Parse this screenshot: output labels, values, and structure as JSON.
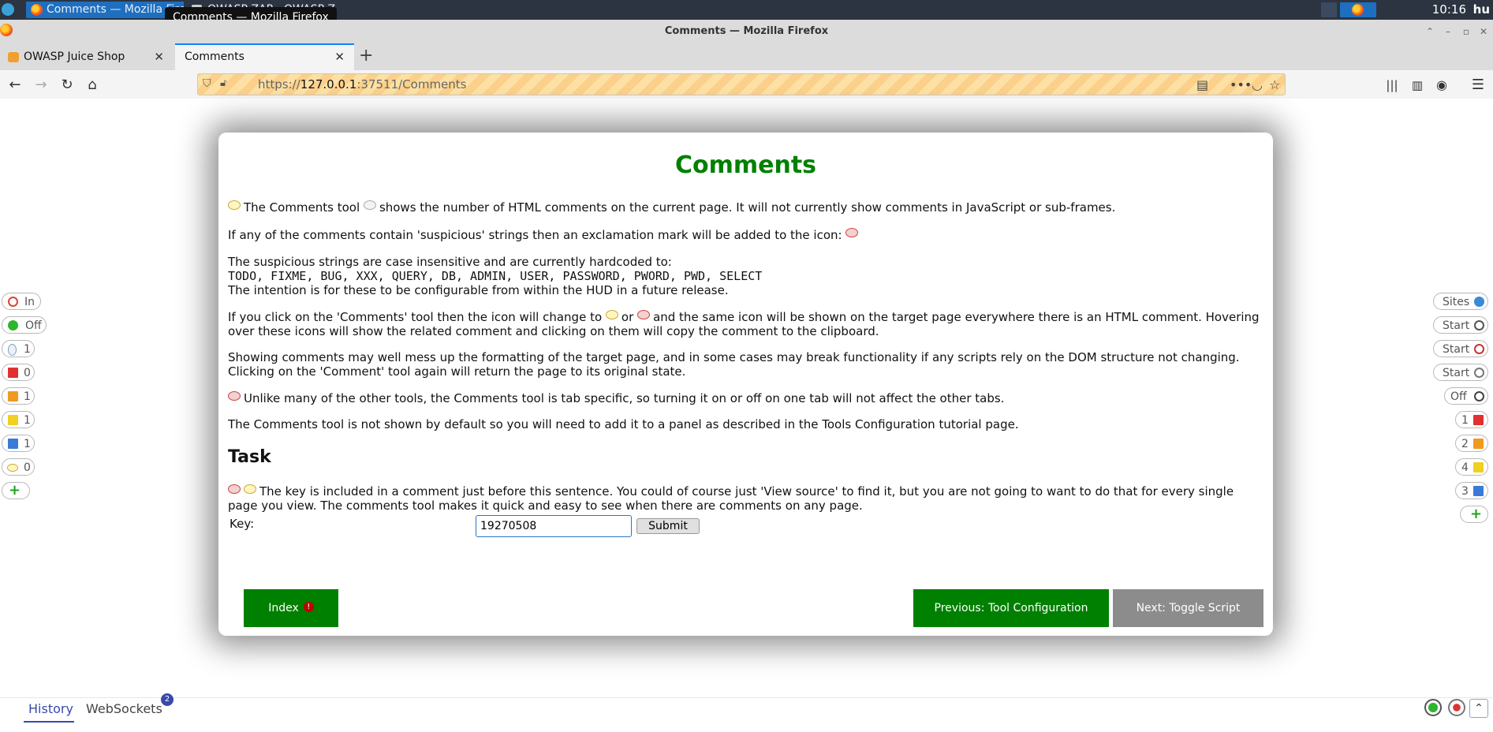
{
  "taskbar": {
    "tasks": [
      "Comments — Mozilla Firefox",
      "OWASP ZAP - OWASP Z..."
    ],
    "tooltip": "Comments — Mozilla Firefox",
    "clock": "10:16",
    "keyboard_layout": "hu"
  },
  "window": {
    "title": "Comments — Mozilla Firefox"
  },
  "tabs": [
    {
      "label": "OWASP Juice Shop",
      "selected": false
    },
    {
      "label": "Comments",
      "selected": true
    }
  ],
  "address": {
    "prefix": "https://",
    "host": "127.0.0.1",
    "rest": ":37511/Comments"
  },
  "dialog": {
    "title": "Comments",
    "p1": "The Comments tool shows the number of HTML comments on the current page. It will not currently show comments in JavaScript or sub-frames.",
    "p1a": "The Comments tool",
    "p1b": "shows the number of HTML comments on the current page. It will not currently show comments in JavaScript or sub-frames.",
    "p2": "If any of the comments contain 'suspicious' strings then an exclamation mark will be added to the icon:",
    "p3_intro": "The suspicious strings are case insensitive and are currently hardcoded to:",
    "p3_code": "TODO, FIXME, BUG, XXX, QUERY, DB, ADMIN, USER, PASSWORD, PWORD, PWD, SELECT",
    "p3_outro": "The intention is for these to be configurable from within the HUD in a future release.",
    "p4a": "If you click on the 'Comments' tool then the icon will change to",
    "p4b": "or",
    "p4c": "and the same icon will be shown on the target page everywhere there is an HTML comment. Hovering over these icons will show the related comment and clicking on them will copy the comment to the clipboard.",
    "p5": "Showing comments may well mess up the formatting of the target page, and in some cases may break functionality if any scripts rely on the DOM structure not changing. Clicking on the 'Comment' tool again will return the page to its original state.",
    "p6": "Unlike many of the other tools, the Comments tool is tab specific, so turning it on or off on one tab will not affect the other tabs.",
    "p7": "The Comments tool is not shown by default so you will need to add it to a panel as described in the Tools Configuration tutorial page.",
    "task_heading": "Task",
    "task_text": "The key is included in a comment just before this sentence. You could of course just 'View source' to find it, but you are not going to want to do that for every single page you view. The comments tool makes it quick and easy to see when there are comments on any page.",
    "key_label": "Key:",
    "key_value": "19270508",
    "submit_label": "Submit",
    "index_label": "Index",
    "prev_label": "Previous: Tool Configuration",
    "next_label": "Next: Toggle Script"
  },
  "hud_left": [
    {
      "label": "In",
      "icon": "target-icon"
    },
    {
      "label": "Off",
      "icon": "green-dot-icon"
    },
    {
      "label": "1",
      "icon": "lightbulb-icon"
    },
    {
      "label": "0",
      "icon": "red-flag-icon"
    },
    {
      "label": "1",
      "icon": "orange-flag-icon"
    },
    {
      "label": "1",
      "icon": "yellow-flag-icon"
    },
    {
      "label": "1",
      "icon": "blue-flag-icon"
    },
    {
      "label": "0",
      "icon": "comments-icon"
    }
  ],
  "hud_right": [
    {
      "label": "Sites",
      "icon": "globe-icon"
    },
    {
      "label": "Start",
      "icon": "spider-icon"
    },
    {
      "label": "Start",
      "icon": "ajax-spider-icon"
    },
    {
      "label": "Start",
      "icon": "active-scan-icon"
    },
    {
      "label": "Off",
      "icon": "break-icon"
    },
    {
      "label": "1",
      "icon": "red-flag-icon"
    },
    {
      "label": "2",
      "icon": "orange-flag-icon"
    },
    {
      "label": "4",
      "icon": "yellow-flag-icon"
    },
    {
      "label": "3",
      "icon": "blue-flag-icon"
    }
  ],
  "bottom": {
    "history": "History",
    "websockets": "WebSockets",
    "ws_count": "2"
  },
  "colors": {
    "accent_green": "#008000",
    "next_grey": "#8c8c8c",
    "tab_accent": "#0a84ff",
    "hud_tab": "#3949ab"
  }
}
